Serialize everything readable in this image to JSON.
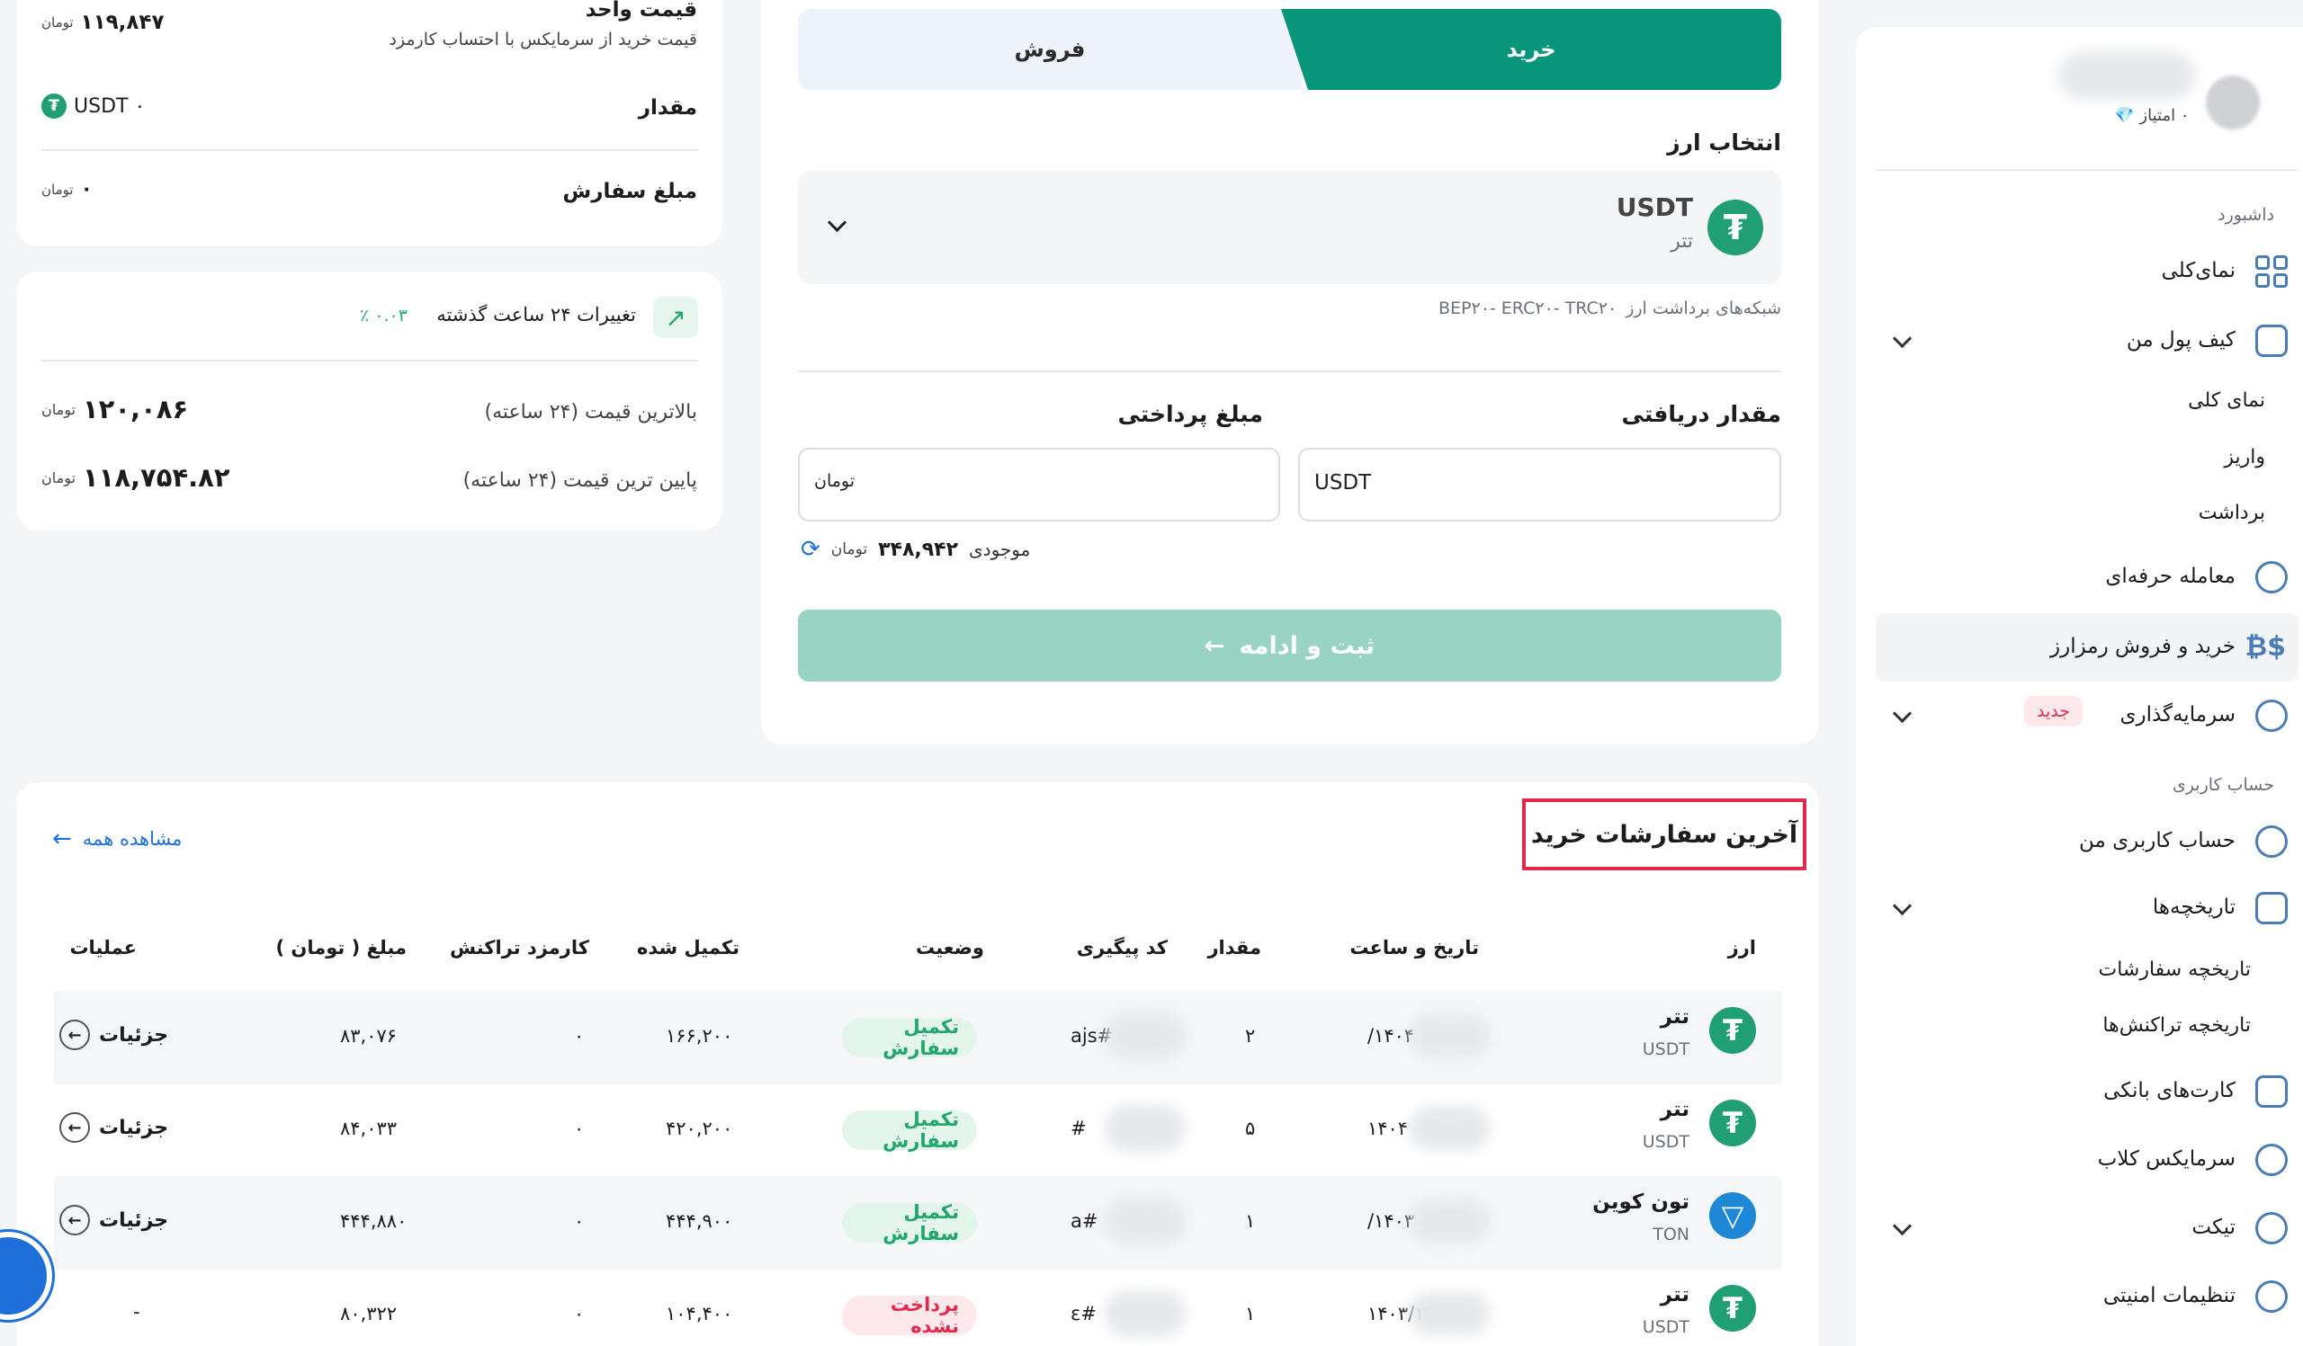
{
  "colors": {
    "accent": "#07967a",
    "accent_light": "#98d3c3",
    "danger": "#e22a4a",
    "success": "#1ea86b",
    "link": "#1e6fd9"
  },
  "sidebar": {
    "score": "۰ امتیاز",
    "dashboard_heading": "داشبورد",
    "overview": "نمای‌کلی",
    "wallet": "کیف پول من",
    "wallet_sub": {
      "overview": "نمای کلی",
      "deposit": "واریز",
      "withdraw": "برداشت"
    },
    "pro_trade": "معامله حرفه‌ای",
    "buy_sell": "خرید و فروش رمزارز",
    "investment": "سرمایه‌گذاری",
    "new_badge": "جدید",
    "account_heading": "حساب کاربری",
    "my_account": "حساب کاربری من",
    "histories": "تاریخچه‌ها",
    "histories_sub": {
      "orders": "تاریخچه سفارشات",
      "transactions": "تاریخچه تراکنش‌ها"
    },
    "bank_cards": "کارت‌های بانکی",
    "club": "سرمایکس کلاب",
    "ticket": "تیکت",
    "security": "تنظیمات امنیتی"
  },
  "trade": {
    "buy_tab": "خرید",
    "sell_tab": "فروش",
    "select_currency_label": "انتخاب ارز",
    "currency_symbol": "USDT",
    "currency_name": "تتر",
    "networks_label": "شبکه‌های برداشت ارز",
    "networks": "BEP۲۰- ERC۲۰- TRC۲۰",
    "receive_label": "مقدار دریافتی",
    "pay_label": "مبلغ پرداختی",
    "receive_unit": "USDT",
    "pay_unit": "تومان",
    "balance_label": "موجودی",
    "balance_value": "۳۴۸,۹۴۲",
    "balance_unit": "تومان",
    "submit": "ثبت و ادامه"
  },
  "summary": {
    "unit_price_label": "قیمت واحد",
    "unit_price_sub": "قیمت خرید از سرمایکس با احتساب کارمزد",
    "unit_price_value": "۱۱۹,۸۴۷",
    "unit": "تومان",
    "amount_label": "مقدار",
    "amount_value": "۰ USDT",
    "order_label": "مبلغ سفارش",
    "order_value": "۰"
  },
  "stats": {
    "change_label": "تغییرات ۲۴ ساعت گذشته",
    "change_value": "۰.۰۳ ٪",
    "high_label": "بالاترین قیمت (۲۴ ساعته)",
    "high_value": "۱۲۰,۰۸۶",
    "low_label": "پایین ترین قیمت (۲۴ ساعته)",
    "low_value": "۱۱۸,۷۵۴.۸۲",
    "unit": "تومان"
  },
  "orders": {
    "title": "آخرین سفارشات خرید",
    "view_all": "مشاهده همه",
    "columns": [
      "ارز",
      "تاریخ و ساعت",
      "مقدار",
      "کد پیگیری",
      "وضعیت",
      "تکمیل شده",
      "کارمزد تراکنش",
      "مبلغ ( تومان )",
      "عملیات"
    ],
    "rows": [
      {
        "icon": "₮",
        "name": "تتر",
        "symbol": "USDT",
        "date": "۱۴۰۴/",
        "amount": "۲",
        "code": "#ajs",
        "status": "تکمیل سفارش",
        "status_type": "ok",
        "filled": "۱۶۶,۲۰۰",
        "fee": "۰",
        "price": "۸۳,۰۷۶",
        "action": "جزئیات"
      },
      {
        "icon": "₮",
        "name": "تتر",
        "symbol": "USDT",
        "date": "۱۴۰۴",
        "amount": "۵",
        "code": "#",
        "status": "تکمیل سفارش",
        "status_type": "ok",
        "filled": "۴۲۰,۲۰۰",
        "fee": "۰",
        "price": "۸۴,۰۳۳",
        "action": "جزئیات"
      },
      {
        "icon": "▽",
        "name": "تون کوین",
        "symbol": "TON",
        "date": "۱۴۰۳/",
        "amount": "۱",
        "code": "#a",
        "status": "تکمیل سفارش",
        "status_type": "ok",
        "filled": "۴۴۴,۹۰۰",
        "fee": "۰",
        "price": "۴۴۴,۸۸۰",
        "action": "جزئیات"
      },
      {
        "icon": "₮",
        "name": "تتر",
        "symbol": "USDT",
        "date": "۱۴۰۳/۱",
        "amount": "۱",
        "code": "#ε",
        "status": "پرداخت نشده",
        "status_type": "no",
        "filled": "۱۰۴,۴۰۰",
        "fee": "۰",
        "price": "۸۰,۳۲۲",
        "action": "-"
      }
    ]
  }
}
